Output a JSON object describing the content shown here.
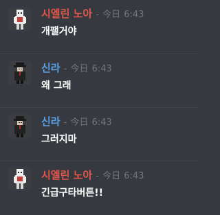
{
  "messages": [
    {
      "author": "시엘린 노아",
      "author_color": "#e5564a",
      "separator": "-",
      "day": "今日",
      "time": "6:43",
      "text": "개팰거야",
      "avatar": "white-haired-character-avatar"
    },
    {
      "author": "신라",
      "author_color": "#5aa0e6",
      "separator": "-",
      "day": "今日",
      "time": "6:43",
      "text": "왜 그래",
      "avatar": "dark-cloaked-character-avatar"
    },
    {
      "author": "신라",
      "author_color": "#5aa0e6",
      "separator": "-",
      "day": "今日",
      "time": "6:43",
      "text": "그러지마",
      "avatar": "dark-cloaked-character-avatar"
    },
    {
      "author": "시엘린 노아",
      "author_color": "#e5564a",
      "separator": "-",
      "day": "今日",
      "time": "6:43",
      "text": "긴급구타버튼!!",
      "avatar": "white-haired-character-avatar"
    }
  ]
}
